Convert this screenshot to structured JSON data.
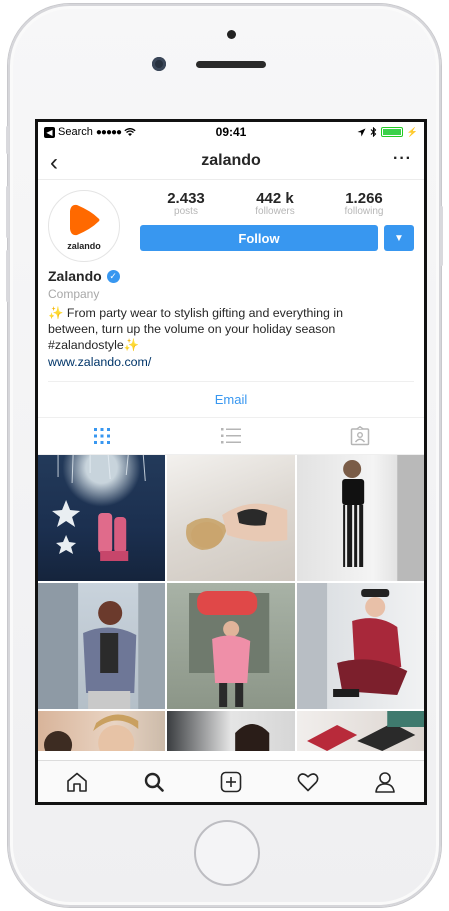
{
  "status_bar": {
    "back_app": "Search",
    "signal": "●●●●●",
    "time": "09:41"
  },
  "navbar": {
    "title": "zalando",
    "more": "···"
  },
  "profile": {
    "avatar_text": "zalando",
    "stats": [
      {
        "value": "2.433",
        "label": "posts"
      },
      {
        "value": "442 k",
        "label": "followers"
      },
      {
        "value": "1.266",
        "label": "following"
      }
    ],
    "follow_label": "Follow",
    "name": "Zalando",
    "category": "Company",
    "bio_line1": "✨ From party wear to stylish gifting and everything in",
    "bio_line2": "between, turn up the volume on your holiday season",
    "bio_line3": "#zalandostyle✨",
    "website": "www.zalando.com/",
    "email_label": "Email"
  },
  "colors": {
    "accent": "#3897f0",
    "brand_orange": "#ff6900",
    "link": "#003569"
  },
  "icons": {
    "tabs": [
      "grid-icon",
      "list-icon",
      "tagged-icon"
    ],
    "bottom_bar": [
      "home-icon",
      "search-icon",
      "add-post-icon",
      "heart-icon",
      "profile-icon"
    ]
  }
}
